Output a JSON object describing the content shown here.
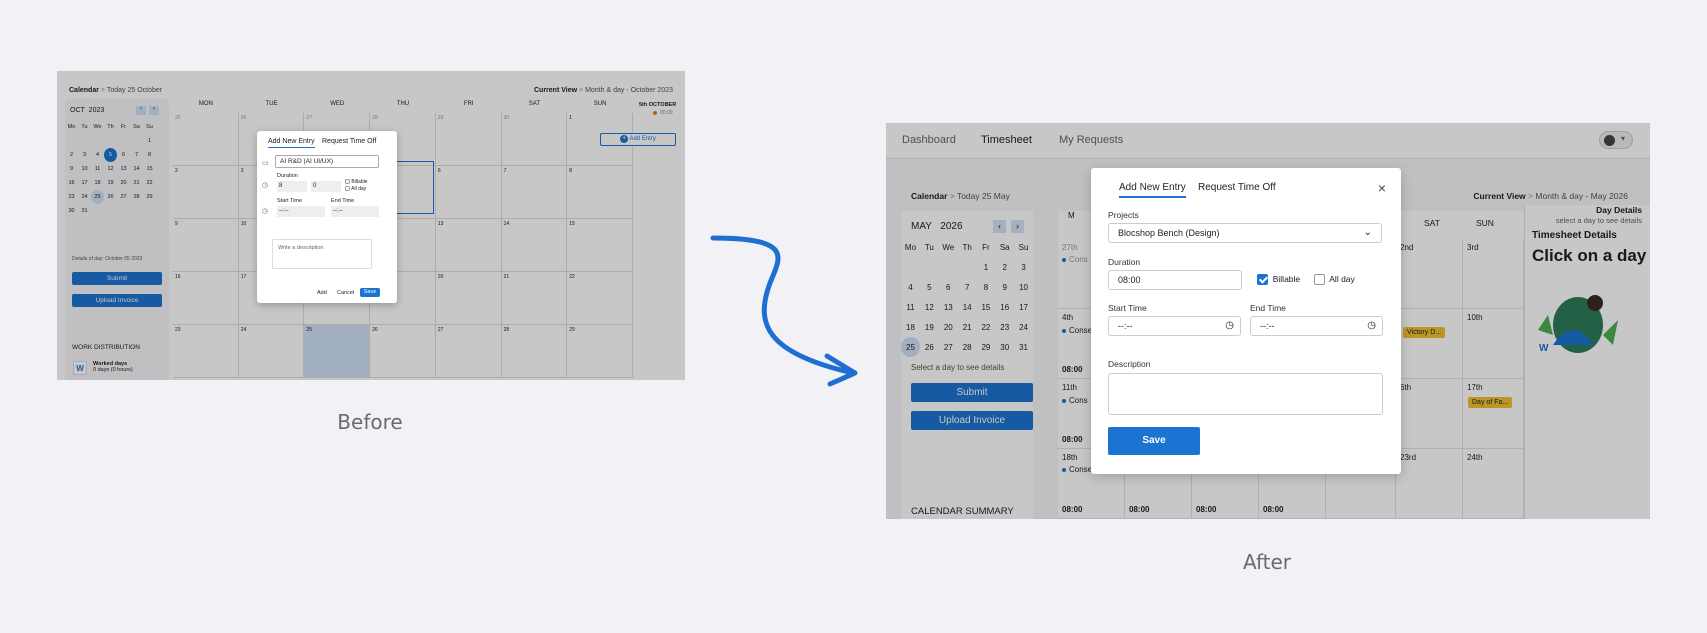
{
  "captions": {
    "before": "Before",
    "after": "After"
  },
  "before": {
    "breadcrumb": {
      "root": "Calendar",
      "sep": ">",
      "current": "Today 25 October"
    },
    "view": {
      "label": "Current View",
      "sep": ">",
      "value": "Month & day - October 2023"
    },
    "mini": {
      "month": "OCT",
      "year": "2023",
      "weekdays": [
        "Mo",
        "Tu",
        "We",
        "Th",
        "Fr",
        "Sa",
        "Su"
      ],
      "rows": [
        [
          "",
          "",
          "",
          "",
          "",
          "",
          "1"
        ],
        [
          "2",
          "3",
          "4",
          "5",
          "6",
          "7",
          "8"
        ],
        [
          "9",
          "10",
          "11",
          "12",
          "13",
          "14",
          "15"
        ],
        [
          "16",
          "17",
          "18",
          "19",
          "20",
          "21",
          "22"
        ],
        [
          "23",
          "24",
          "25",
          "26",
          "27",
          "28",
          "29"
        ],
        [
          "30",
          "31",
          "",
          "",
          "",
          "",
          ""
        ]
      ]
    },
    "details_text": "Details of day: October 05 2023",
    "submit": "Submit",
    "upload": "Upload Invoice",
    "work_dist": "WORK DISTRIBUTION",
    "worked_days": "Worked days",
    "worked_value": "0 days (0 hours)",
    "w_letter": "W",
    "days": [
      "MON",
      "TUE",
      "WED",
      "THU",
      "FRI",
      "SAT",
      "SUN"
    ],
    "weeks": [
      [
        "25",
        "26",
        "27",
        "28",
        "29",
        "30",
        "1"
      ],
      [
        "2",
        "3",
        "4",
        "5",
        "6",
        "7",
        "8"
      ],
      [
        "9",
        "10",
        "11",
        "12",
        "13",
        "14",
        "15"
      ],
      [
        "16",
        "17",
        "18",
        "19",
        "20",
        "21",
        "22"
      ],
      [
        "23",
        "24",
        "25",
        "26",
        "27",
        "28",
        "29"
      ]
    ],
    "day_panel": {
      "title": "5th OCTOBER",
      "time": "00:00",
      "add": "Add Entry"
    },
    "modal": {
      "tab1": "Add New Entry",
      "tab2": "Request Time Off",
      "project": "AI R&D (AI UI/UX)",
      "duration_label": "Duration",
      "hours": "8",
      "minutes": "0",
      "billable": "Billable",
      "allday": "All day",
      "start_label": "Start Time",
      "end_label": "End Time",
      "time_placeholder": "--:--",
      "description_placeholder": "Write a description",
      "add": "Add",
      "cancel": "Cancel",
      "save": "Save"
    }
  },
  "after": {
    "nav": [
      "Dashboard",
      "Timesheet",
      "My Requests"
    ],
    "breadcrumb": {
      "root": "Calendar",
      "sep": ">",
      "current": "Today 25 May"
    },
    "view": {
      "label": "Current View",
      "sep": ">",
      "value": "Month & day - May 2026"
    },
    "mini": {
      "month": "MAY",
      "year": "2026",
      "weekdays": [
        "Mo",
        "Tu",
        "We",
        "Th",
        "Fr",
        "Sa",
        "Su"
      ],
      "rows": [
        [
          "",
          "",
          "",
          "",
          "1",
          "2",
          "3"
        ],
        [
          "4",
          "5",
          "6",
          "7",
          "8",
          "9",
          "10"
        ],
        [
          "11",
          "12",
          "13",
          "14",
          "15",
          "16",
          "17"
        ],
        [
          "18",
          "19",
          "20",
          "21",
          "22",
          "23",
          "24"
        ],
        [
          "25",
          "26",
          "27",
          "28",
          "29",
          "30",
          "31"
        ]
      ]
    },
    "select_hint": "Select a day to see details",
    "submit": "Submit",
    "upload": "Upload Invoice",
    "summary": "CALENDAR SUMMARY",
    "col_sat": "SAT",
    "col_sun": "SUN",
    "day_details": {
      "title": "Day Details",
      "hint": "select a day to see details",
      "ts_title": "Timesheet Details",
      "cta": "Click on a day"
    },
    "cells": {
      "c27": "27th",
      "c4": "4th",
      "c11": "11th",
      "c18": "18th",
      "c3": "3rd",
      "c10": "10th",
      "c17": "17th",
      "c24": "24th",
      "c2nd": "2nd",
      "c16": "6th",
      "c23": "23rd"
    },
    "consensium": "Consensium",
    "time0800": "08:00",
    "tag_victory": "Victory D...",
    "tag_day": "Day of Fa...",
    "modal": {
      "tab1": "Add New Entry",
      "tab2": "Request Time Off",
      "close": "×",
      "projects_label": "Projects",
      "project": "Blocshop Bench (Design)",
      "duration_label": "Duration",
      "duration": "08:00",
      "billable": "Billable",
      "allday": "All day",
      "start_label": "Start Time",
      "end_label": "End Time",
      "time_placeholder": "--:--",
      "description_label": "Description",
      "save": "Save"
    }
  },
  "colors": {
    "accent": "#1b74d1",
    "tag": "#f2c230",
    "arrow": "#1e6fd1"
  }
}
